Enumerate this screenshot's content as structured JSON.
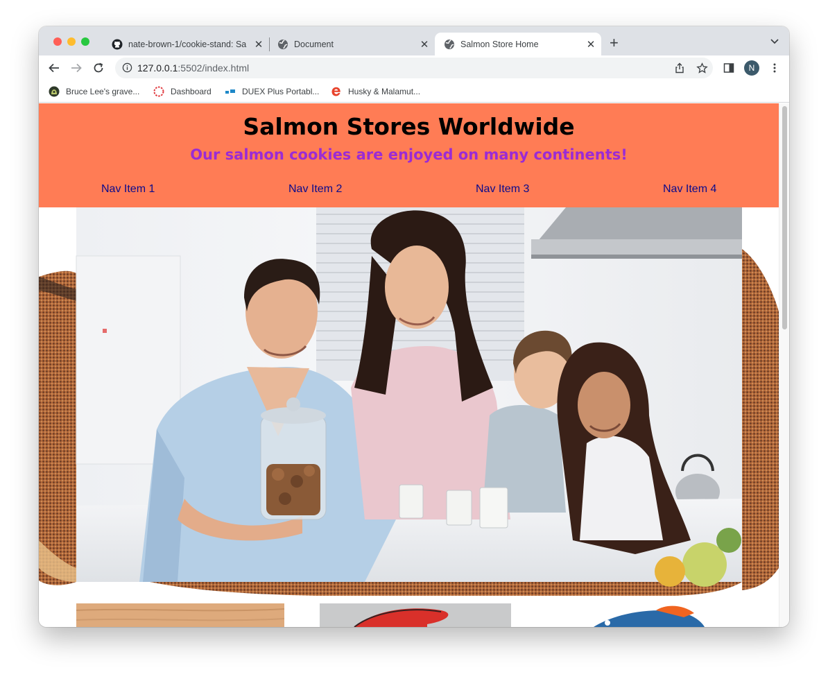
{
  "browser": {
    "tabs": [
      {
        "title": "nate-brown-1/cookie-stand: Sa",
        "favicon": "github-icon"
      },
      {
        "title": "Document",
        "favicon": "globe-icon"
      },
      {
        "title": "Salmon Store Home",
        "favicon": "globe-icon"
      }
    ],
    "url": {
      "host": "127.0.0.1",
      "rest": ":5502/index.html"
    },
    "profile_initial": "N",
    "bookmarks": [
      {
        "label": "Bruce Lee's grave...",
        "icon": "findagrave-icon"
      },
      {
        "label": "Dashboard",
        "icon": "dashboard-icon"
      },
      {
        "label": "DUEX Plus Portabl...",
        "icon": "duex-icon"
      },
      {
        "label": "Husky & Malamut...",
        "icon": "e-logo-icon"
      }
    ]
  },
  "page": {
    "title": "Salmon Stores Worldwide",
    "subtitle": "Our salmon cookies are enjoyed on many continents!",
    "nav": [
      "Nav Item 1",
      "Nav Item 2",
      "Nav Item 3",
      "Nav Item 4"
    ],
    "colors": {
      "header_bg": "#ff7c55",
      "subtitle": "#9b2bd4",
      "nav_link": "#0a0a8c"
    }
  }
}
